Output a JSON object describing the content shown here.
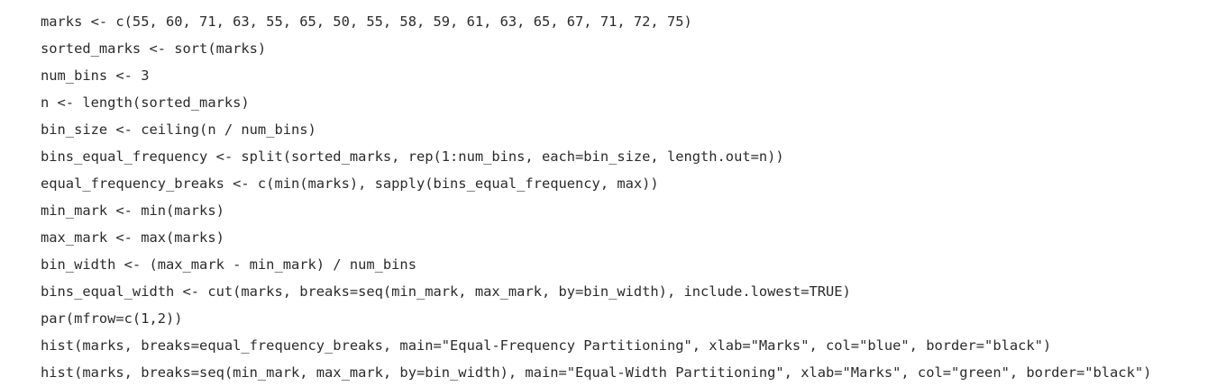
{
  "code": {
    "lines": [
      "marks <- c(55, 60, 71, 63, 55, 65, 50, 55, 58, 59, 61, 63, 65, 67, 71, 72, 75)",
      "sorted_marks <- sort(marks)",
      "num_bins <- 3",
      "n <- length(sorted_marks)",
      "bin_size <- ceiling(n / num_bins)",
      "bins_equal_frequency <- split(sorted_marks, rep(1:num_bins, each=bin_size, length.out=n))",
      "equal_frequency_breaks <- c(min(marks), sapply(bins_equal_frequency, max))",
      "min_mark <- min(marks)",
      "max_mark <- max(marks)",
      "bin_width <- (max_mark - min_mark) / num_bins",
      "bins_equal_width <- cut(marks, breaks=seq(min_mark, max_mark, by=bin_width), include.lowest=TRUE)",
      "par(mfrow=c(1,2))",
      "hist(marks, breaks=equal_frequency_breaks, main=\"Equal-Frequency Partitioning\", xlab=\"Marks\", col=\"blue\", border=\"black\")",
      "hist(marks, breaks=seq(min_mark, max_mark, by=bin_width), main=\"Equal-Width Partitioning\", xlab=\"Marks\", col=\"green\", border=\"black\")"
    ]
  }
}
